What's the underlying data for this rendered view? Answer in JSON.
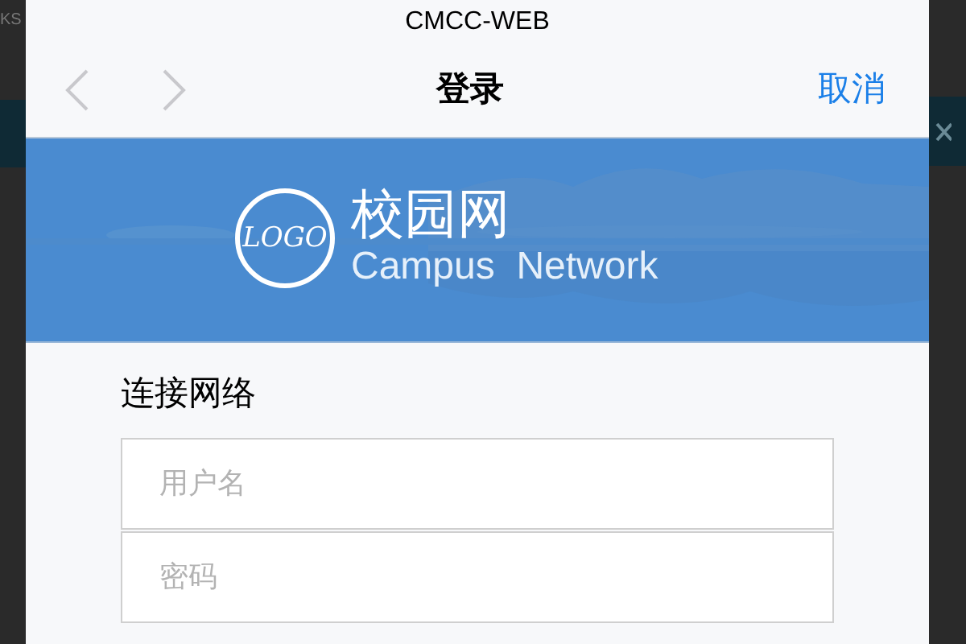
{
  "background": {
    "corner_text": "KS"
  },
  "sheet": {
    "network_name": "CMCC-WEB",
    "nav": {
      "back": {
        "disabled": true
      },
      "forward": {
        "disabled": true
      },
      "title": "登录",
      "cancel": "取消"
    },
    "banner": {
      "logo_text": "LOGO",
      "title": "校园网",
      "subtitle": "Campus  Network"
    },
    "form": {
      "heading": "连接网络",
      "fields": [
        {
          "placeholder": "用户名"
        },
        {
          "placeholder": "密码"
        }
      ]
    }
  }
}
